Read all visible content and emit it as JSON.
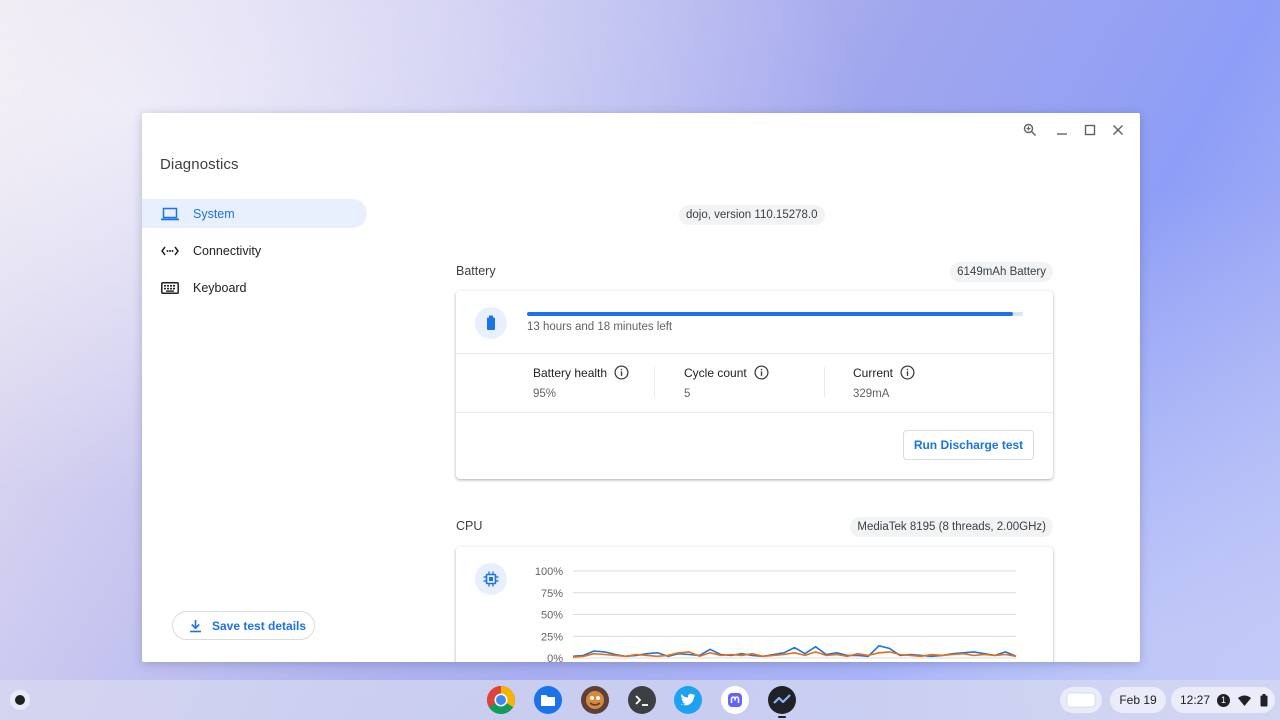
{
  "app": {
    "title": "Diagnostics"
  },
  "window_controls": [
    "zoom-icon",
    "minimize-icon",
    "maximize-icon",
    "close-icon"
  ],
  "sidebar": {
    "items": [
      {
        "label": "System",
        "icon": "laptop-icon",
        "active": true
      },
      {
        "label": "Connectivity",
        "icon": "connectivity-icon",
        "active": false
      },
      {
        "label": "Keyboard",
        "icon": "keyboard-icon",
        "active": false
      }
    ],
    "save_label": "Save test details"
  },
  "version": "dojo, version 110.15278.0",
  "battery": {
    "title": "Battery",
    "capacity": "6149mAh Battery",
    "charge_fraction": 0.98,
    "time_left": "13 hours and 18 minutes left",
    "stats": [
      {
        "label": "Battery health",
        "value": "95%"
      },
      {
        "label": "Cycle count",
        "value": "5"
      },
      {
        "label": "Current",
        "value": "329mA"
      }
    ],
    "run_label": "Run Discharge test"
  },
  "cpu": {
    "title": "CPU",
    "info": "MediaTek 8195 (8 threads, 2.00GHz)"
  },
  "chart_data": {
    "type": "line",
    "y_ticks": [
      "100%",
      "75%",
      "50%",
      "25%",
      "0%"
    ],
    "ylim": [
      0,
      100
    ],
    "grid": true,
    "series": [
      {
        "color": "#1a73e8",
        "values": [
          2,
          3,
          8,
          7,
          4,
          2,
          3,
          5,
          6,
          2,
          5,
          4,
          3,
          10,
          4,
          3,
          5,
          3,
          2,
          4,
          6,
          12,
          5,
          13,
          4,
          6,
          3,
          3,
          2,
          14,
          11,
          3,
          4,
          3,
          2,
          3,
          5,
          6,
          7,
          5,
          3,
          7,
          2
        ]
      },
      {
        "color": "#e8710a",
        "values": [
          1,
          2,
          5,
          4,
          3,
          2,
          4,
          3,
          2,
          3,
          6,
          7,
          2,
          6,
          3,
          4,
          3,
          5,
          2,
          3,
          4,
          6,
          3,
          7,
          3,
          4,
          2,
          5,
          3,
          6,
          7,
          4,
          3,
          2,
          4,
          3,
          4,
          5,
          3,
          4,
          3,
          4,
          2
        ]
      }
    ]
  },
  "shelf": {
    "apps": [
      "chrome-icon",
      "files-icon",
      "app-icon",
      "terminal-icon",
      "twitter-icon",
      "mastodon-icon",
      "diagnostics-icon"
    ],
    "date": "Feb 19",
    "time": "12:27",
    "notification_count": "1"
  }
}
